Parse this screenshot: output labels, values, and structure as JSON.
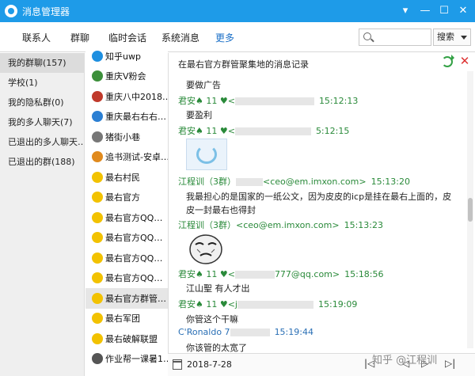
{
  "window": {
    "title": "消息管理器",
    "controls": [
      "▾",
      "—",
      "☐",
      "✕"
    ]
  },
  "nav": {
    "tabs": [
      "联系人",
      "群聊",
      "临时会话",
      "系统消息",
      "更多"
    ],
    "active": "更多",
    "search_placeholder": "",
    "search_scope": "搜索"
  },
  "left_panel": {
    "items": [
      "我的群聊(157)",
      "学校(1)",
      "我的隐私群(0)",
      "我的多人聊天(7)",
      "已退出的多人聊天…",
      "已退出的群(188)"
    ],
    "selected_index": 0
  },
  "group_list": {
    "items": [
      {
        "name": "知乎uwp",
        "color": "#1e8fe0"
      },
      {
        "name": "重庆V粉会",
        "color": "#3c8f3a"
      },
      {
        "name": "重庆八中2018…",
        "color": "#c0392b"
      },
      {
        "name": "重庆最右右右…",
        "color": "#2b7fd3"
      },
      {
        "name": "猪街小巷",
        "color": "#777777"
      },
      {
        "name": "追书测试-安卓…",
        "color": "#e08a1e"
      },
      {
        "name": "最右村民",
        "color": "#f2c200"
      },
      {
        "name": "最右官方",
        "color": "#f2c200"
      },
      {
        "name": "最右官方QQ…",
        "color": "#f2c200"
      },
      {
        "name": "最右官方QQ…",
        "color": "#f2c200"
      },
      {
        "name": "最右官方QQ…",
        "color": "#f2c200"
      },
      {
        "name": "最右官方QQ…",
        "color": "#f2c200"
      },
      {
        "name": "最右官方群管…",
        "color": "#f2c200"
      },
      {
        "name": "最右军团",
        "color": "#f2c200"
      },
      {
        "name": "最右破解联盟",
        "color": "#f2c200"
      },
      {
        "name": "作业帮一课暑1…",
        "color": "#555555"
      }
    ],
    "selected_index": 12
  },
  "chat": {
    "header": "在最右官方群管聚集地的消息记录",
    "messages": [
      {
        "text": "要做广告"
      },
      {
        "sender": "君安♠   11  ♥<",
        "time": "15:12:13",
        "text": "要盈利"
      },
      {
        "sender": "君安♠   11  ♥<",
        "time": "5:12:15"
      },
      {
        "sender": "江程训（3群）",
        "email": "<ceo@em.imxon.com>",
        "time": "15:13:20",
        "text": "我最担心的是国家的一纸公文，因为皮皮的icp是挂在最右上面的，皮",
        "text2": "皮一封最右也得封"
      },
      {
        "sender": "江程训（3群）",
        "email": "<ceo@em.imxon.com>",
        "time": "15:13:23"
      },
      {
        "sender": "君安♠   11  ♥<",
        "email": "777@qq.com>",
        "time": "15:18:56",
        "text": "江山聖 有人才出"
      },
      {
        "sender": "君安♠   11  ♥<j",
        "time": "15:19:09",
        "text": "你管这个干嘛"
      },
      {
        "sender": "C'Ronaldo  7",
        "time": "15:19:44",
        "text": "你该管的太宽了"
      }
    ]
  },
  "bottom": {
    "date": "2018-7-28",
    "pager": [
      "|◁",
      "◁",
      "▷",
      "▷|"
    ]
  },
  "watermark": "知乎 @江程训",
  "colors": {
    "titlebar": "#1e9be8",
    "active_tab": "#1a6fc7",
    "sender": "#2a8a3a"
  }
}
